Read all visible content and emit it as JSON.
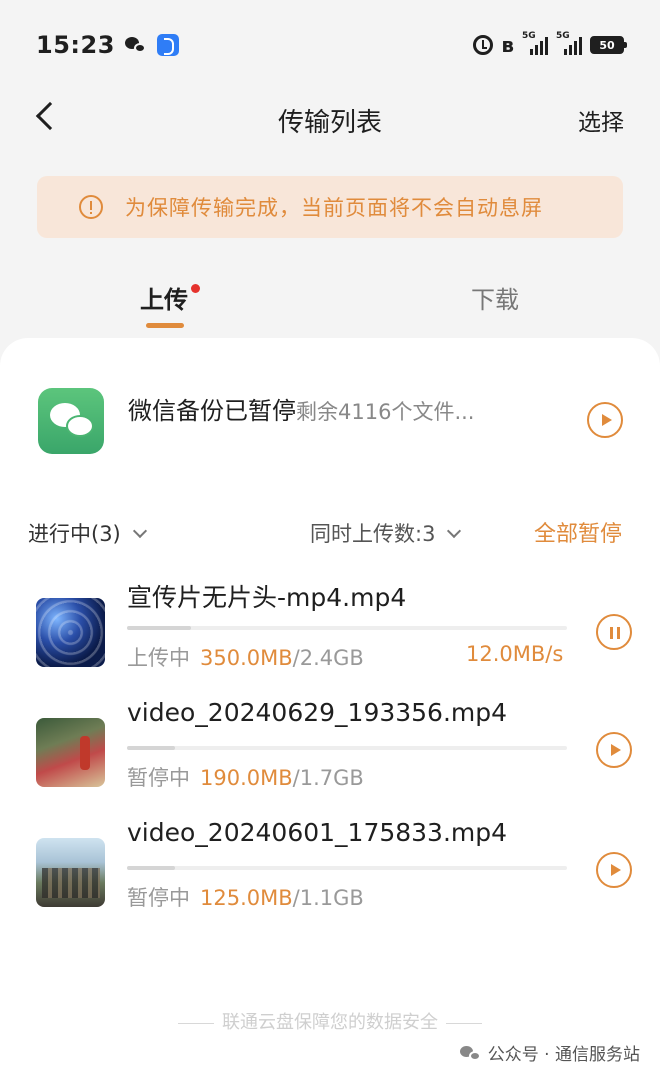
{
  "status_bar": {
    "time": "15:23",
    "network_tag_1": "5G",
    "network_tag_2": "5G",
    "battery": "50"
  },
  "header": {
    "title": "传输列表",
    "select_label": "选择"
  },
  "notice": {
    "text": "为保障传输完成，当前页面将不会自动息屏",
    "color": "#e08b3c"
  },
  "tabs": {
    "upload_label": "上传",
    "download_label": "下载",
    "active": "upload"
  },
  "backup": {
    "title": "微信备份已暂停",
    "subtitle": "剩余4116个文件..."
  },
  "list_header": {
    "in_progress_label": "进行中(3)",
    "concurrent_label": "同时上传数:3",
    "pause_all_label": "全部暂停"
  },
  "files": [
    {
      "name": "宣传片无片头-mp4.mp4",
      "status": "上传中",
      "done": "350.0MB",
      "total": "/2.4GB",
      "speed": "12.0MB/s",
      "progress": 0.146,
      "action": "pause"
    },
    {
      "name": "video_20240629_193356.mp4",
      "status": "暂停中",
      "done": "190.0MB",
      "total": "/1.7GB",
      "speed": "",
      "progress": 0.11,
      "action": "play"
    },
    {
      "name": "video_20240601_175833.mp4",
      "status": "暂停中",
      "done": "125.0MB",
      "total": "/1.1GB",
      "speed": "",
      "progress": 0.11,
      "action": "play"
    }
  ],
  "footer": {
    "text": "联通云盘保障您的数据安全"
  },
  "watermark": {
    "text": "公众号 · 通信服务站"
  },
  "colors": {
    "accent": "#e08b3c",
    "notice_bg": "#f8e6d9",
    "badge_dot": "#e5322d"
  }
}
